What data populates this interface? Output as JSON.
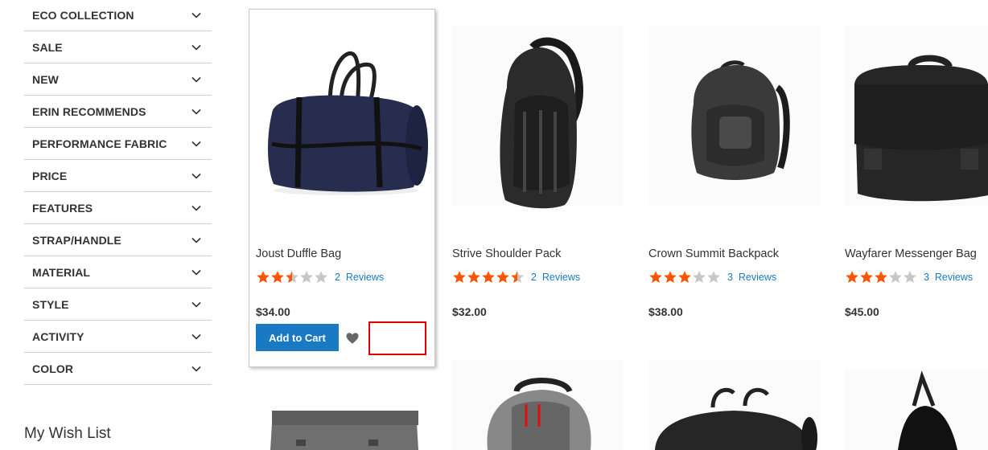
{
  "sidebar": {
    "filters": [
      {
        "label": "ECO COLLECTION"
      },
      {
        "label": "SALE"
      },
      {
        "label": "NEW"
      },
      {
        "label": "ERIN RECOMMENDS"
      },
      {
        "label": "PERFORMANCE FABRIC"
      },
      {
        "label": "PRICE"
      },
      {
        "label": "FEATURES"
      },
      {
        "label": "STRAP/HANDLE"
      },
      {
        "label": "MATERIAL"
      },
      {
        "label": "STYLE"
      },
      {
        "label": "ACTIVITY"
      },
      {
        "label": "COLOR"
      }
    ],
    "wishlist_title": "My Wish List"
  },
  "products": [
    {
      "name": "Joust Duffle Bag",
      "rating": 2.5,
      "reviews_count": "2",
      "reviews_label": "Reviews",
      "price": "$34.00"
    },
    {
      "name": "Strive Shoulder Pack",
      "rating": 4.5,
      "reviews_count": "2",
      "reviews_label": "Reviews",
      "price": "$32.00"
    },
    {
      "name": "Crown Summit Backpack",
      "rating": 3.0,
      "reviews_count": "3",
      "reviews_label": "Reviews",
      "price": "$38.00"
    },
    {
      "name": "Wayfarer Messenger Bag",
      "rating": 3.0,
      "reviews_count": "3",
      "reviews_label": "Reviews",
      "price": "$45.00"
    }
  ],
  "active_card": {
    "add_to_cart_label": "Add to Cart",
    "wishlist_icon": "heart-icon"
  },
  "colors": {
    "accent": "#1979c3",
    "star": "#ff5501",
    "star_empty": "#c7c7c7",
    "highlight": "#e00000"
  }
}
